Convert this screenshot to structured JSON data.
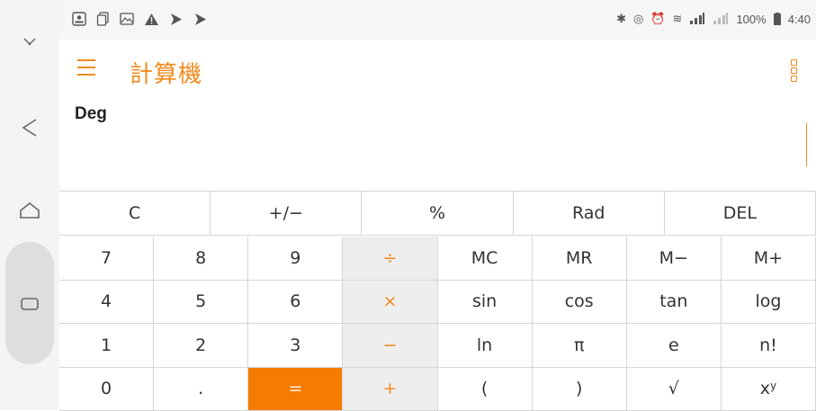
{
  "app": {
    "title": "計算機",
    "accent": "#f28a1d"
  },
  "status": {
    "battery": "100%",
    "time": "4:40"
  },
  "display": {
    "mode": "Deg",
    "expression": ""
  },
  "keys": {
    "row1": [
      "C",
      "+/−",
      "%",
      "Rad",
      "DEL"
    ],
    "grid": [
      [
        "7",
        "8",
        "9",
        "÷",
        "MC",
        "MR",
        "M−",
        "M+"
      ],
      [
        "4",
        "5",
        "6",
        "×",
        "sin",
        "cos",
        "tan",
        "log"
      ],
      [
        "1",
        "2",
        "3",
        "−",
        "ln",
        "π",
        "e",
        "n!"
      ],
      [
        "0",
        ".",
        "=",
        "+",
        "(",
        ")",
        "√",
        "x"
      ]
    ],
    "pow_base": "x",
    "pow_exp": "y"
  },
  "colors": {
    "accent": "#f28a1d",
    "equals_bg": "#f57c00",
    "operator_bg": "#eeeeee"
  }
}
